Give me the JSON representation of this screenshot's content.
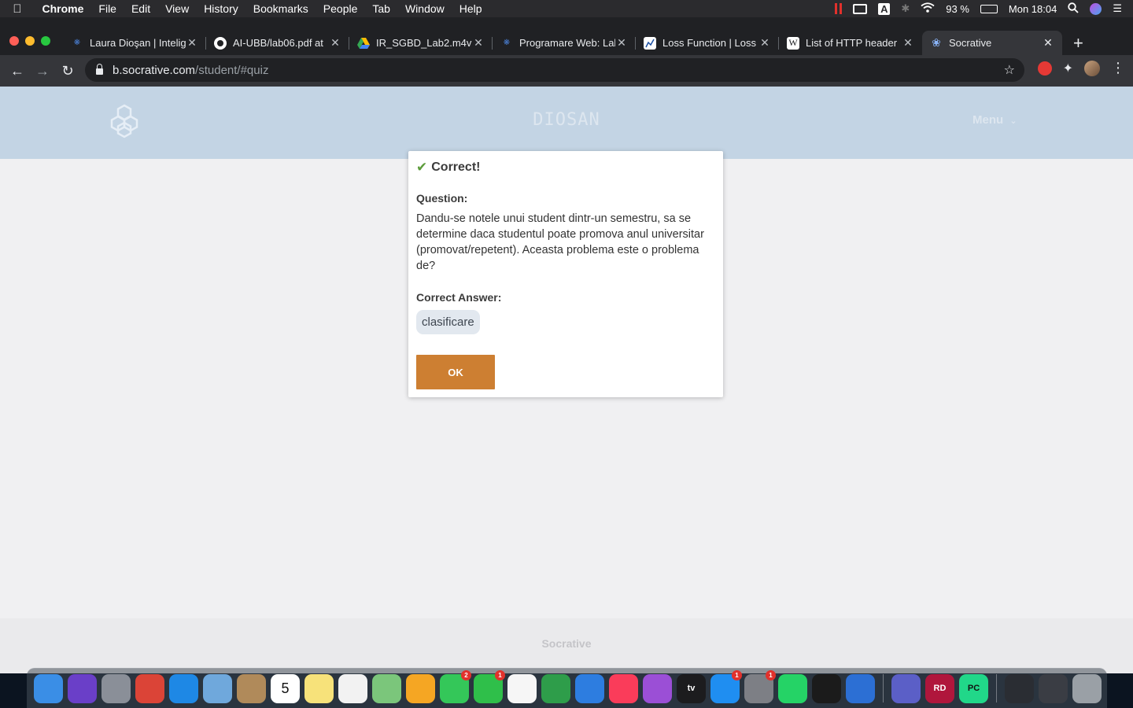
{
  "menubar": {
    "app": "Chrome",
    "items": [
      "File",
      "Edit",
      "View",
      "History",
      "Bookmarks",
      "People",
      "Tab",
      "Window",
      "Help"
    ],
    "battery": "93 %",
    "clock": "Mon 18:04",
    "input_source": "A"
  },
  "tabs": [
    {
      "title": "Laura Dioşan | Intelig",
      "favicon": "globe-icon",
      "color": "#4a7fd4"
    },
    {
      "title": "AI-UBB/lab06.pdf at",
      "favicon": "github-icon",
      "color": "#ffffff"
    },
    {
      "title": "IR_SGBD_Lab2.m4v",
      "favicon": "google-drive-icon",
      "color": "#34a853"
    },
    {
      "title": "Programare Web: Lal",
      "favicon": "globe-icon",
      "color": "#4a7fd4"
    },
    {
      "title": "Loss Function | Loss",
      "favicon": "chart-icon",
      "color": "#ffffff"
    },
    {
      "title": "List of HTTP header",
      "favicon": "wikipedia-icon",
      "color": "#ffffff"
    },
    {
      "title": "Socrative",
      "favicon": "socrative-icon",
      "color": "#8ab4f8"
    }
  ],
  "address": {
    "host": "b.socrative.com",
    "path": "/student/#quiz"
  },
  "page": {
    "room_name": "DIOSAN",
    "menu_label": "Menu",
    "footer_brand": "Socrative"
  },
  "modal": {
    "status": "Correct!",
    "question_label": "Question:",
    "question_text": "Dandu-se notele unui student dintr-un semestru, sa se determine daca studentul poate promova anul universitar (promovat/repetent). Aceasta problema este o problema de?",
    "answer_label": "Correct Answer:",
    "answer": "clasificare",
    "ok_label": "OK",
    "accent_color": "#cd7f32",
    "success_color": "#5c9c3b"
  },
  "dock": {
    "apps": [
      {
        "name": "finder-icon",
        "color": "#3a8ee6",
        "badge": ""
      },
      {
        "name": "siri-icon",
        "color": "#6a3fc8",
        "badge": ""
      },
      {
        "name": "launchpad-icon",
        "color": "#8a8f98",
        "badge": ""
      },
      {
        "name": "chrome-icon",
        "color": "#db4437",
        "badge": ""
      },
      {
        "name": "safari-icon",
        "color": "#1e88e5",
        "badge": ""
      },
      {
        "name": "preview-icon",
        "color": "#6fa8dc",
        "badge": ""
      },
      {
        "name": "contacts-icon",
        "color": "#b08a5a",
        "badge": ""
      },
      {
        "name": "calendar-icon",
        "color": "#ffffff",
        "badge": "",
        "text": "5"
      },
      {
        "name": "notes-icon",
        "color": "#f7e27a",
        "badge": ""
      },
      {
        "name": "reminders-icon",
        "color": "#f2f2f2",
        "badge": ""
      },
      {
        "name": "maps-icon",
        "color": "#7bc67b",
        "badge": ""
      },
      {
        "name": "photos-icon",
        "color": "#f5a623",
        "badge": ""
      },
      {
        "name": "messages-icon",
        "color": "#34c759",
        "badge": "2"
      },
      {
        "name": "facetime-icon",
        "color": "#2fbf4a",
        "badge": "1"
      },
      {
        "name": "freeform-icon",
        "color": "#f6f6f6",
        "badge": ""
      },
      {
        "name": "numbers-icon",
        "color": "#2e9d4a",
        "badge": ""
      },
      {
        "name": "keynote-icon",
        "color": "#2d7de0",
        "badge": ""
      },
      {
        "name": "music-icon",
        "color": "#fa3c5a",
        "badge": ""
      },
      {
        "name": "podcasts-icon",
        "color": "#9b4fd6",
        "badge": ""
      },
      {
        "name": "apple-tv-icon",
        "color": "#1c1c1e",
        "badge": "",
        "text": "tv"
      },
      {
        "name": "app-store-icon",
        "color": "#1f8ef1",
        "badge": "1"
      },
      {
        "name": "system-preferences-icon",
        "color": "#7d7f85",
        "badge": "1"
      },
      {
        "name": "whatsapp-icon",
        "color": "#25d366",
        "badge": ""
      },
      {
        "name": "terminal-icon",
        "color": "#1b1b1b",
        "badge": ""
      },
      {
        "name": "parallels-icon",
        "color": "#2c6fd4",
        "badge": ""
      },
      {
        "name": "teams-icon",
        "color": "#5b5fc7",
        "badge": ""
      },
      {
        "name": "rider-icon",
        "color": "#b0163c",
        "badge": "",
        "text": "RD"
      },
      {
        "name": "pycharm-icon",
        "color": "#21d789",
        "badge": "",
        "text": "PC"
      },
      {
        "name": "screen-thumbnail-icon",
        "color": "#2a2d33",
        "badge": ""
      },
      {
        "name": "window-thumbnail-icon",
        "color": "#3a3d44",
        "badge": ""
      },
      {
        "name": "trash-icon",
        "color": "#9aa0a6",
        "badge": ""
      }
    ]
  }
}
